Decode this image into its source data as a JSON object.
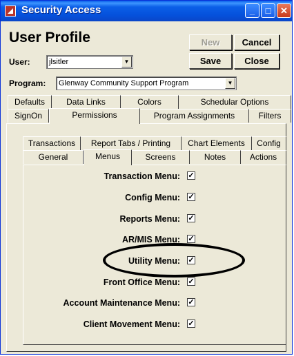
{
  "window": {
    "title": "Security Access"
  },
  "header": {
    "title": "User Profile",
    "user_label": "User:",
    "user_value": "jlsitler",
    "program_label": "Program:",
    "program_value": "Glenway Community Support Program"
  },
  "buttons": {
    "new": "New",
    "cancel": "Cancel",
    "save": "Save",
    "close": "Close"
  },
  "tabs_row1": [
    "Defaults",
    "Data Links",
    "Colors",
    "Schedular Options"
  ],
  "tabs_row2": [
    "SignOn",
    "Permissions",
    "Program Assignments",
    "Filters"
  ],
  "subtabs_row1": [
    "Transactions",
    "Report Tabs / Printing",
    "Chart Elements",
    "Config"
  ],
  "subtabs_row2": [
    "General",
    "Menus",
    "Screens",
    "Notes",
    "Actions"
  ],
  "menus": [
    {
      "label": "Transaction Menu:",
      "checked": true
    },
    {
      "label": "Config Menu:",
      "checked": true
    },
    {
      "label": "Reports Menu:",
      "checked": true
    },
    {
      "label": "AR/MIS Menu:",
      "checked": true
    },
    {
      "label": "Utility Menu:",
      "checked": true
    },
    {
      "label": "Front Office Menu:",
      "checked": true
    },
    {
      "label": "Account Maintenance Menu:",
      "checked": true
    },
    {
      "label": "Client Movement Menu:",
      "checked": true
    }
  ],
  "checkmark": "✓"
}
